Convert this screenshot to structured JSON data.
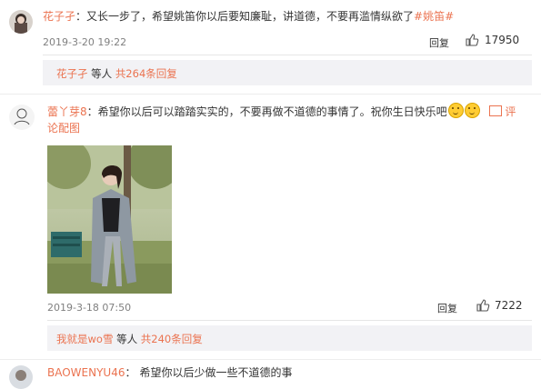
{
  "comment1": {
    "username": "花子孑",
    "separator": "：",
    "text": "又长一步了，希望姚笛你以后要知廉耻，讲道德，不要再滥情纵欲了",
    "hashtag": "#姚笛#",
    "timestamp": "2019-3-20 19:22",
    "reply_label": "回复",
    "likes": "17950",
    "replies_summary": {
      "user": "花子孑",
      "mid": "等人",
      "link": "共264条回复"
    }
  },
  "comment2": {
    "username": "蕾丫芽8",
    "separator": "：",
    "text": "希望你以后可以踏踏实实的，不要再做不道德的事情了。祝你生日快乐吧",
    "comment_link_line1": "评",
    "comment_link_line2": "论配图",
    "timestamp": "2019-3-18 07:50",
    "reply_label": "回复",
    "likes": "7222",
    "replies_summary": {
      "user": "我就是wo雪",
      "mid": "等人",
      "link": "共240条回复"
    }
  },
  "comment3": {
    "username": "BAOWENYU46",
    "separator": "：",
    "text": "希望你以后少做一些不道德的事"
  },
  "colors": {
    "link": "#eb7350",
    "text": "#333333",
    "meta": "#808080",
    "reply_bg": "#f2f2f5"
  },
  "icons": {
    "reply_icon": "comment-icon",
    "like_icon": "thumbs-up-icon"
  }
}
